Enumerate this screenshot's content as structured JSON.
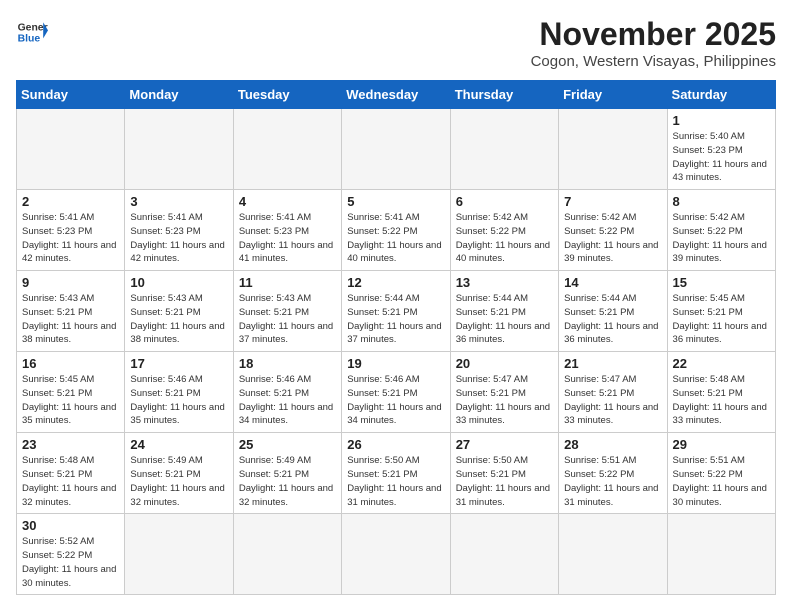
{
  "header": {
    "logo_general": "General",
    "logo_blue": "Blue",
    "month_title": "November 2025",
    "location": "Cogon, Western Visayas, Philippines"
  },
  "weekdays": [
    "Sunday",
    "Monday",
    "Tuesday",
    "Wednesday",
    "Thursday",
    "Friday",
    "Saturday"
  ],
  "weeks": [
    [
      {
        "day": "",
        "info": ""
      },
      {
        "day": "",
        "info": ""
      },
      {
        "day": "",
        "info": ""
      },
      {
        "day": "",
        "info": ""
      },
      {
        "day": "",
        "info": ""
      },
      {
        "day": "",
        "info": ""
      },
      {
        "day": "1",
        "info": "Sunrise: 5:40 AM\nSunset: 5:23 PM\nDaylight: 11 hours and 43 minutes."
      }
    ],
    [
      {
        "day": "2",
        "info": "Sunrise: 5:41 AM\nSunset: 5:23 PM\nDaylight: 11 hours and 42 minutes."
      },
      {
        "day": "3",
        "info": "Sunrise: 5:41 AM\nSunset: 5:23 PM\nDaylight: 11 hours and 42 minutes."
      },
      {
        "day": "4",
        "info": "Sunrise: 5:41 AM\nSunset: 5:23 PM\nDaylight: 11 hours and 41 minutes."
      },
      {
        "day": "5",
        "info": "Sunrise: 5:41 AM\nSunset: 5:22 PM\nDaylight: 11 hours and 40 minutes."
      },
      {
        "day": "6",
        "info": "Sunrise: 5:42 AM\nSunset: 5:22 PM\nDaylight: 11 hours and 40 minutes."
      },
      {
        "day": "7",
        "info": "Sunrise: 5:42 AM\nSunset: 5:22 PM\nDaylight: 11 hours and 39 minutes."
      },
      {
        "day": "8",
        "info": "Sunrise: 5:42 AM\nSunset: 5:22 PM\nDaylight: 11 hours and 39 minutes."
      }
    ],
    [
      {
        "day": "9",
        "info": "Sunrise: 5:43 AM\nSunset: 5:21 PM\nDaylight: 11 hours and 38 minutes."
      },
      {
        "day": "10",
        "info": "Sunrise: 5:43 AM\nSunset: 5:21 PM\nDaylight: 11 hours and 38 minutes."
      },
      {
        "day": "11",
        "info": "Sunrise: 5:43 AM\nSunset: 5:21 PM\nDaylight: 11 hours and 37 minutes."
      },
      {
        "day": "12",
        "info": "Sunrise: 5:44 AM\nSunset: 5:21 PM\nDaylight: 11 hours and 37 minutes."
      },
      {
        "day": "13",
        "info": "Sunrise: 5:44 AM\nSunset: 5:21 PM\nDaylight: 11 hours and 36 minutes."
      },
      {
        "day": "14",
        "info": "Sunrise: 5:44 AM\nSunset: 5:21 PM\nDaylight: 11 hours and 36 minutes."
      },
      {
        "day": "15",
        "info": "Sunrise: 5:45 AM\nSunset: 5:21 PM\nDaylight: 11 hours and 36 minutes."
      }
    ],
    [
      {
        "day": "16",
        "info": "Sunrise: 5:45 AM\nSunset: 5:21 PM\nDaylight: 11 hours and 35 minutes."
      },
      {
        "day": "17",
        "info": "Sunrise: 5:46 AM\nSunset: 5:21 PM\nDaylight: 11 hours and 35 minutes."
      },
      {
        "day": "18",
        "info": "Sunrise: 5:46 AM\nSunset: 5:21 PM\nDaylight: 11 hours and 34 minutes."
      },
      {
        "day": "19",
        "info": "Sunrise: 5:46 AM\nSunset: 5:21 PM\nDaylight: 11 hours and 34 minutes."
      },
      {
        "day": "20",
        "info": "Sunrise: 5:47 AM\nSunset: 5:21 PM\nDaylight: 11 hours and 33 minutes."
      },
      {
        "day": "21",
        "info": "Sunrise: 5:47 AM\nSunset: 5:21 PM\nDaylight: 11 hours and 33 minutes."
      },
      {
        "day": "22",
        "info": "Sunrise: 5:48 AM\nSunset: 5:21 PM\nDaylight: 11 hours and 33 minutes."
      }
    ],
    [
      {
        "day": "23",
        "info": "Sunrise: 5:48 AM\nSunset: 5:21 PM\nDaylight: 11 hours and 32 minutes."
      },
      {
        "day": "24",
        "info": "Sunrise: 5:49 AM\nSunset: 5:21 PM\nDaylight: 11 hours and 32 minutes."
      },
      {
        "day": "25",
        "info": "Sunrise: 5:49 AM\nSunset: 5:21 PM\nDaylight: 11 hours and 32 minutes."
      },
      {
        "day": "26",
        "info": "Sunrise: 5:50 AM\nSunset: 5:21 PM\nDaylight: 11 hours and 31 minutes."
      },
      {
        "day": "27",
        "info": "Sunrise: 5:50 AM\nSunset: 5:21 PM\nDaylight: 11 hours and 31 minutes."
      },
      {
        "day": "28",
        "info": "Sunrise: 5:51 AM\nSunset: 5:22 PM\nDaylight: 11 hours and 31 minutes."
      },
      {
        "day": "29",
        "info": "Sunrise: 5:51 AM\nSunset: 5:22 PM\nDaylight: 11 hours and 30 minutes."
      }
    ],
    [
      {
        "day": "30",
        "info": "Sunrise: 5:52 AM\nSunset: 5:22 PM\nDaylight: 11 hours and 30 minutes."
      },
      {
        "day": "",
        "info": ""
      },
      {
        "day": "",
        "info": ""
      },
      {
        "day": "",
        "info": ""
      },
      {
        "day": "",
        "info": ""
      },
      {
        "day": "",
        "info": ""
      },
      {
        "day": "",
        "info": ""
      }
    ]
  ]
}
